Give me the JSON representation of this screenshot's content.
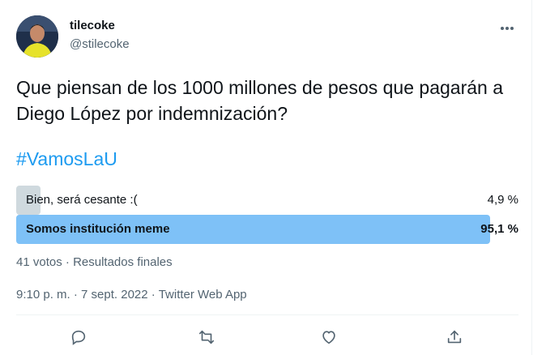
{
  "author": {
    "display_name": "tilecoke",
    "handle": "@stilecoke"
  },
  "tweet": {
    "text": "Que piensan de los 1000 millones de pesos que pagarán a Diego López por indemnización?",
    "hashtag": "#VamosLaU"
  },
  "poll": {
    "options": [
      {
        "label": "Bien, será cesante :(",
        "percent_label": "4,9 %",
        "percent": 4.9,
        "winner": false
      },
      {
        "label": "Somos institución meme",
        "percent_label": "95,1 %",
        "percent": 95.1,
        "winner": true
      }
    ],
    "votes": "41 votos",
    "separator": "·",
    "status": "Resultados finales"
  },
  "meta": {
    "time": "9:10 p. m.",
    "separator": "·",
    "date": "7 sept. 2022",
    "source": "Twitter Web App"
  },
  "icons": {
    "more": "more-horizontal-icon",
    "reply": "reply-icon",
    "retweet": "retweet-icon",
    "like": "like-icon",
    "share": "share-icon"
  },
  "colors": {
    "accent": "#1d9bf0",
    "winner_bar": "#7ec1f7",
    "loser_bar": "#cfd9de",
    "secondary_text": "#536471"
  }
}
